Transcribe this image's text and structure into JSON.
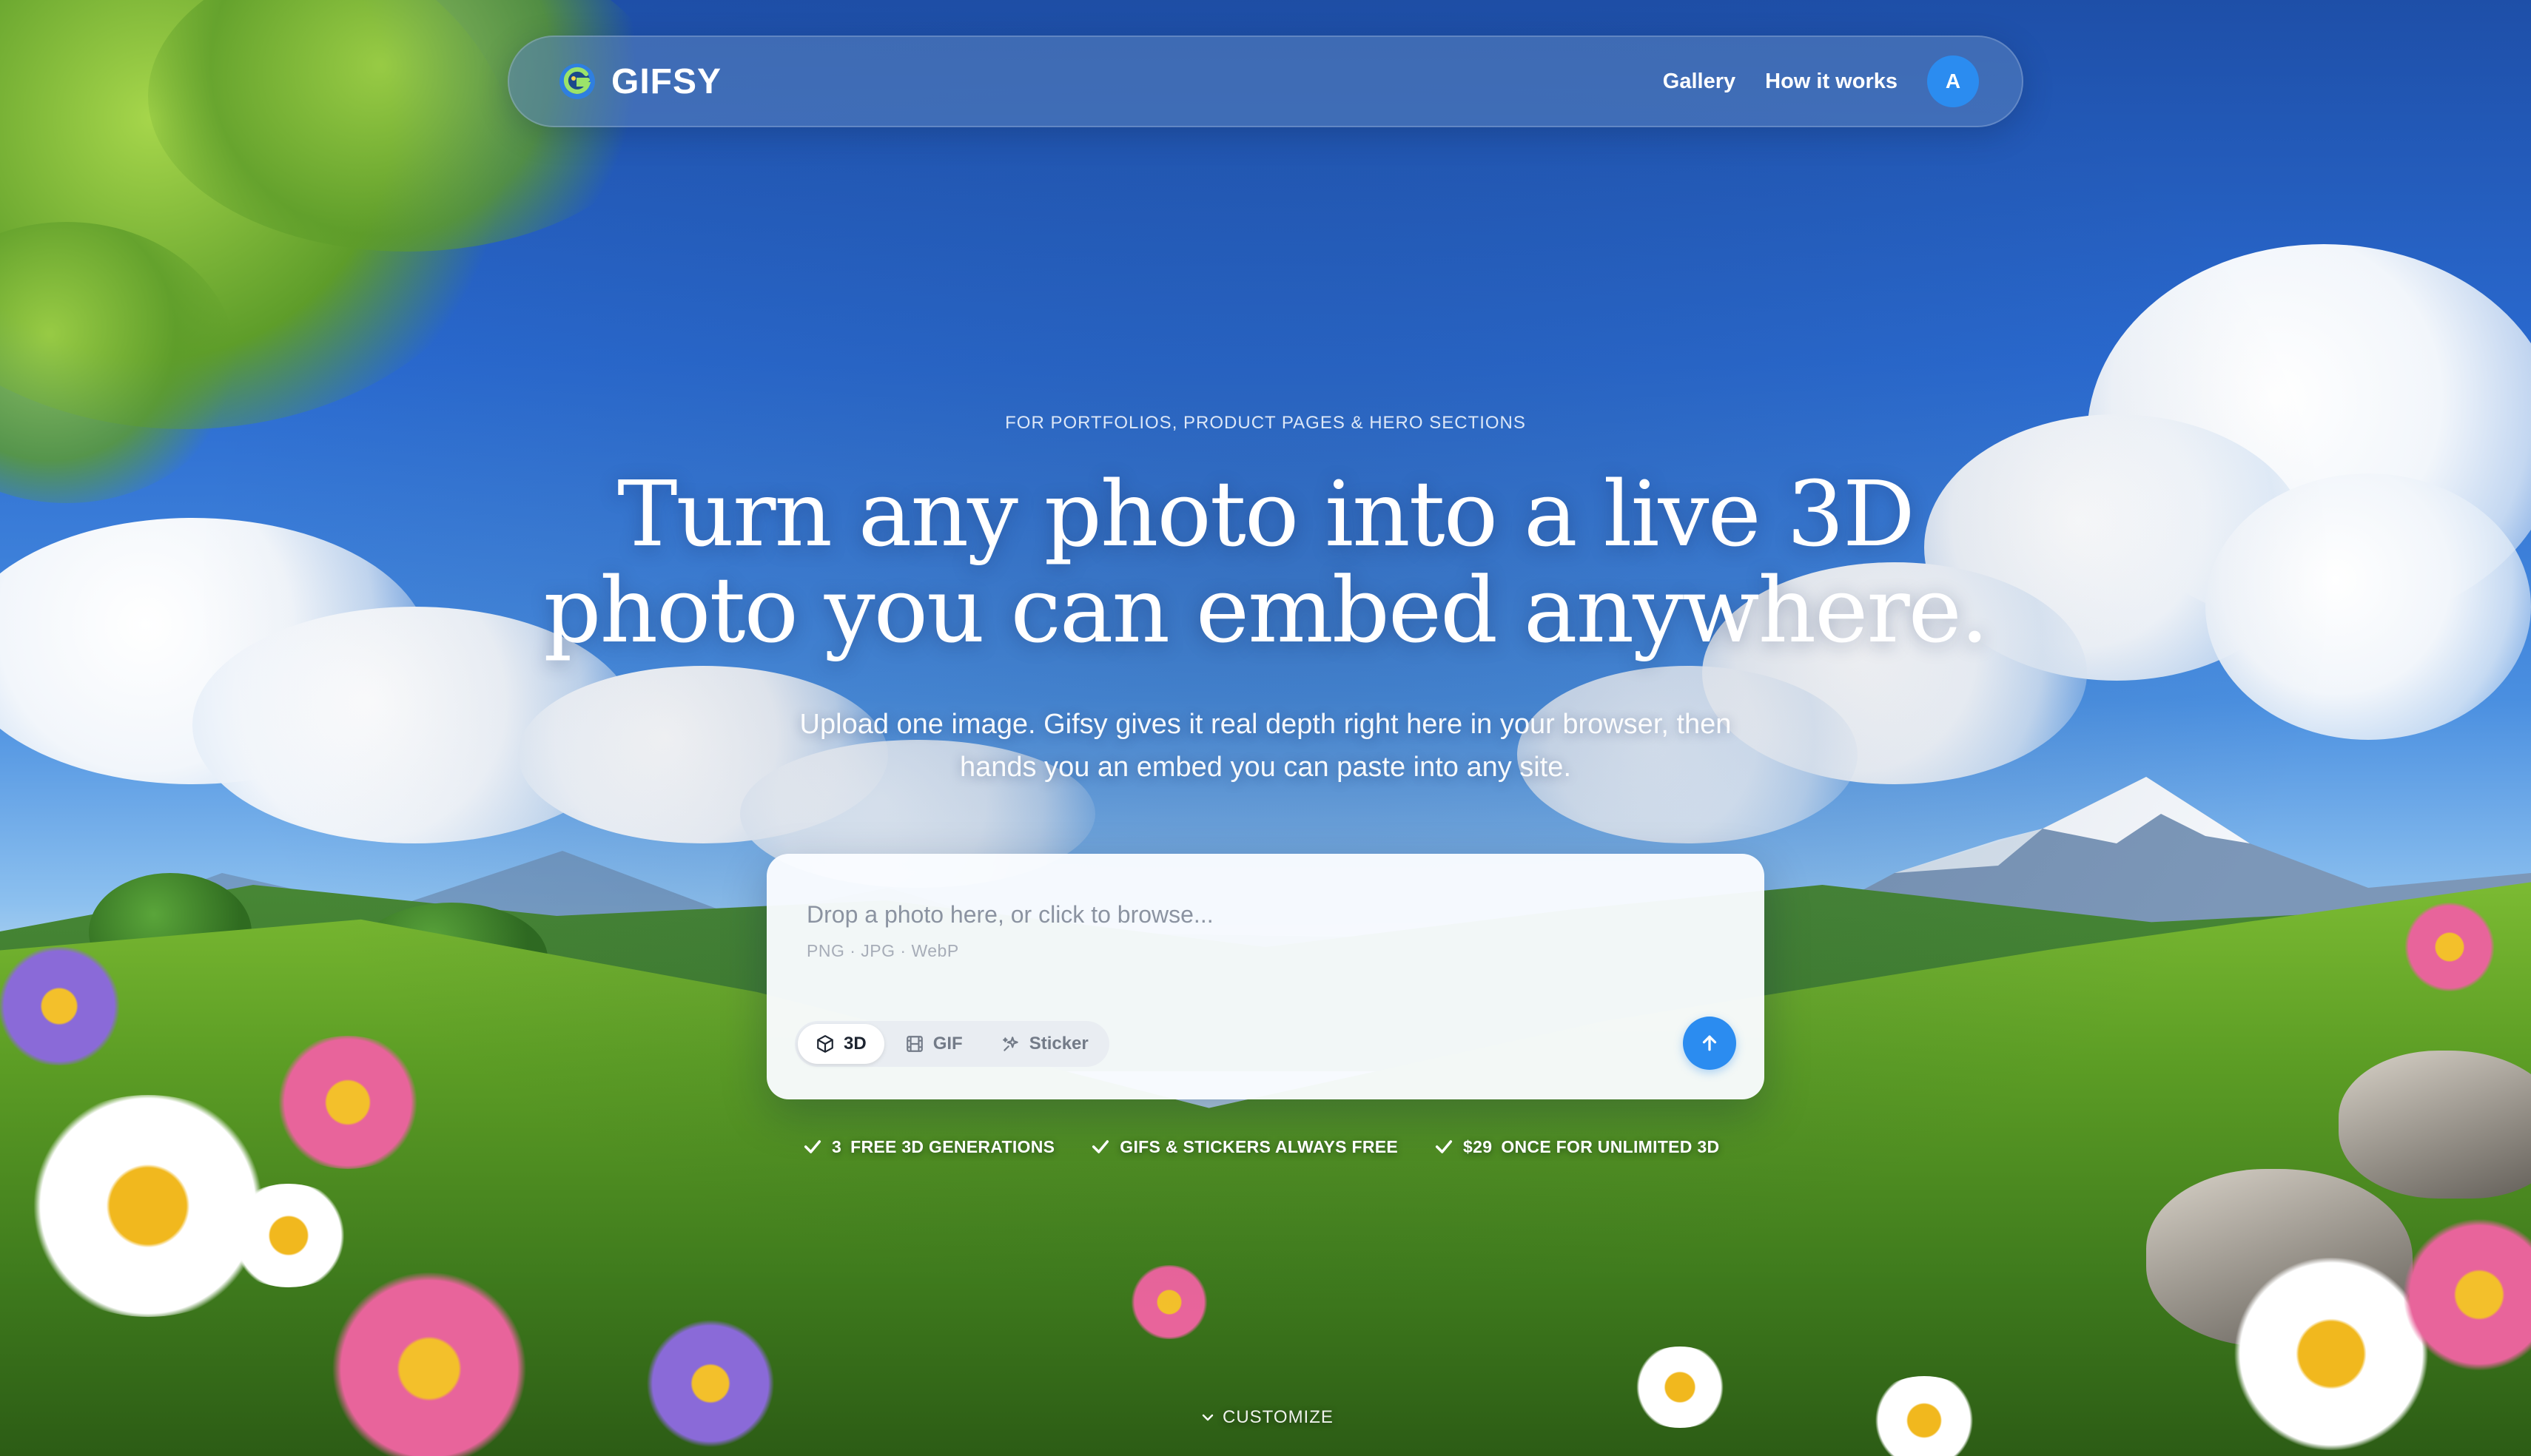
{
  "nav": {
    "brand": "GIFSY",
    "links": [
      {
        "label": "Gallery"
      },
      {
        "label": "How it works"
      }
    ],
    "avatar_initial": "A"
  },
  "hero": {
    "eyebrow": "FOR PORTFOLIOS, PRODUCT PAGES & HERO SECTIONS",
    "headline_line1": "Turn any photo into a live 3D",
    "headline_line2": "photo you can embed anywhere.",
    "subhead_line1": "Upload one image. Gifsy gives it real depth right here in your browser, then",
    "subhead_line2": "hands you an embed you can paste into any site."
  },
  "upload": {
    "placeholder": "Drop a photo here, or click to browse...",
    "formats": "PNG · JPG · WebP",
    "modes": [
      {
        "label": "3D",
        "icon": "cube-icon",
        "active": true
      },
      {
        "label": "GIF",
        "icon": "film-icon",
        "active": false
      },
      {
        "label": "Sticker",
        "icon": "sparkle-icon",
        "active": false
      }
    ],
    "submit_icon": "arrow-up-icon"
  },
  "features": [
    {
      "prefix": "3",
      "text": "FREE 3D GENERATIONS"
    },
    {
      "prefix": "",
      "text": "GIFS & STICKERS ALWAYS FREE"
    },
    {
      "prefix": "$29",
      "text": "ONCE FOR UNLIMITED 3D"
    }
  ],
  "footer": {
    "customize_label": "CUSTOMIZE"
  },
  "colors": {
    "accent": "#2b8cf0",
    "nav_bg": "rgba(90,130,190,0.55)",
    "card_bg": "#fafcff"
  }
}
